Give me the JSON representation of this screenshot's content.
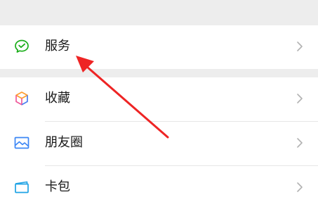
{
  "menu": {
    "items": [
      {
        "label": "服务",
        "icon": "wechat-pay-icon",
        "icon_color": "#1aad19"
      },
      {
        "label": "收藏",
        "icon": "favorites-cube-icon",
        "icon_colors": [
          "#ff9d2f",
          "#f05a9b",
          "#4a7ff0"
        ]
      },
      {
        "label": "朋友圈",
        "icon": "moments-picture-icon",
        "icon_color": "#3b86f5"
      },
      {
        "label": "卡包",
        "icon": "card-wallet-icon",
        "icon_color": "#1fa3e5"
      }
    ],
    "chevron_icon": "chevron-right-icon",
    "chevron_color": "#b2b2b2"
  },
  "annotation": {
    "arrow_color": "#ee2424"
  },
  "colors": {
    "background": "#ffffff",
    "section_gap": "#ededed",
    "divider": "#e6e6e6",
    "text": "#1a1a1a"
  }
}
